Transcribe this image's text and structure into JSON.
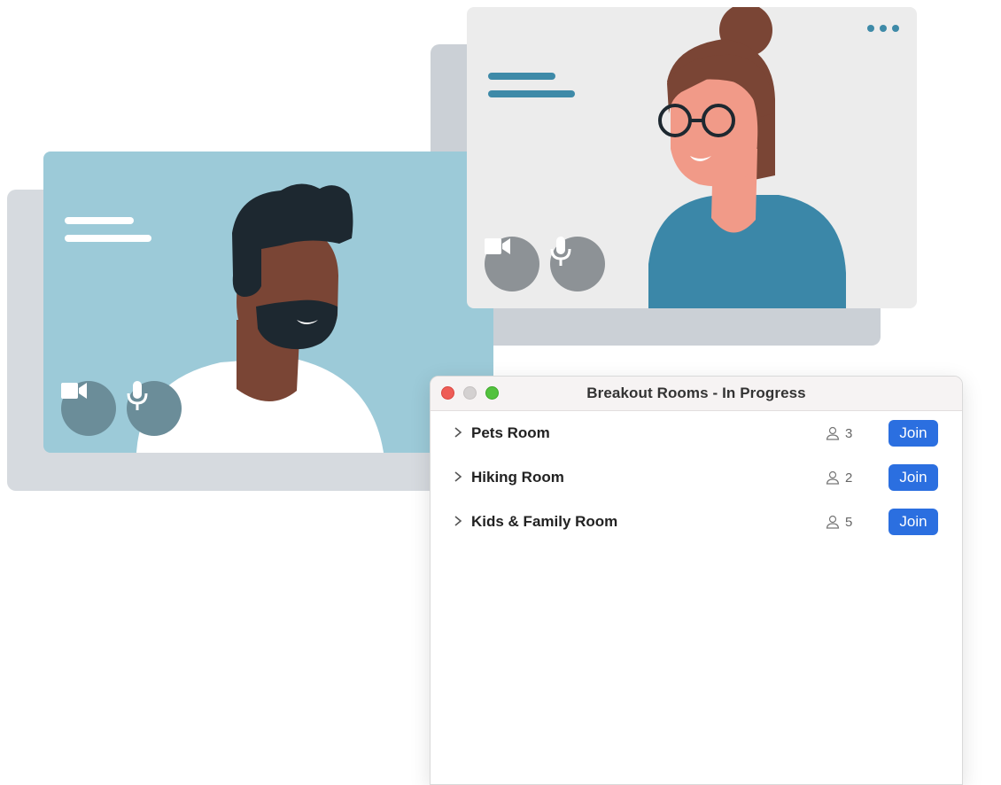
{
  "window": {
    "title": "Breakout Rooms - In Progress"
  },
  "rooms": [
    {
      "name": "Pets Room",
      "participants": "3",
      "join_label": "Join"
    },
    {
      "name": "Hiking Room",
      "participants": "2",
      "join_label": "Join"
    },
    {
      "name": "Kids & Family Room",
      "participants": "5",
      "join_label": "Join"
    }
  ],
  "icons": {
    "camera": "video-camera-icon",
    "mic": "microphone-icon",
    "more": "more-dots-icon",
    "person": "person-icon",
    "chevron": "chevron-right-icon"
  },
  "colors": {
    "join_button": "#2b6fe0",
    "tile_man_bg": "#9ccad8",
    "tile_woman_bg": "#ececec",
    "accent_lines": "#3e8aa8"
  }
}
